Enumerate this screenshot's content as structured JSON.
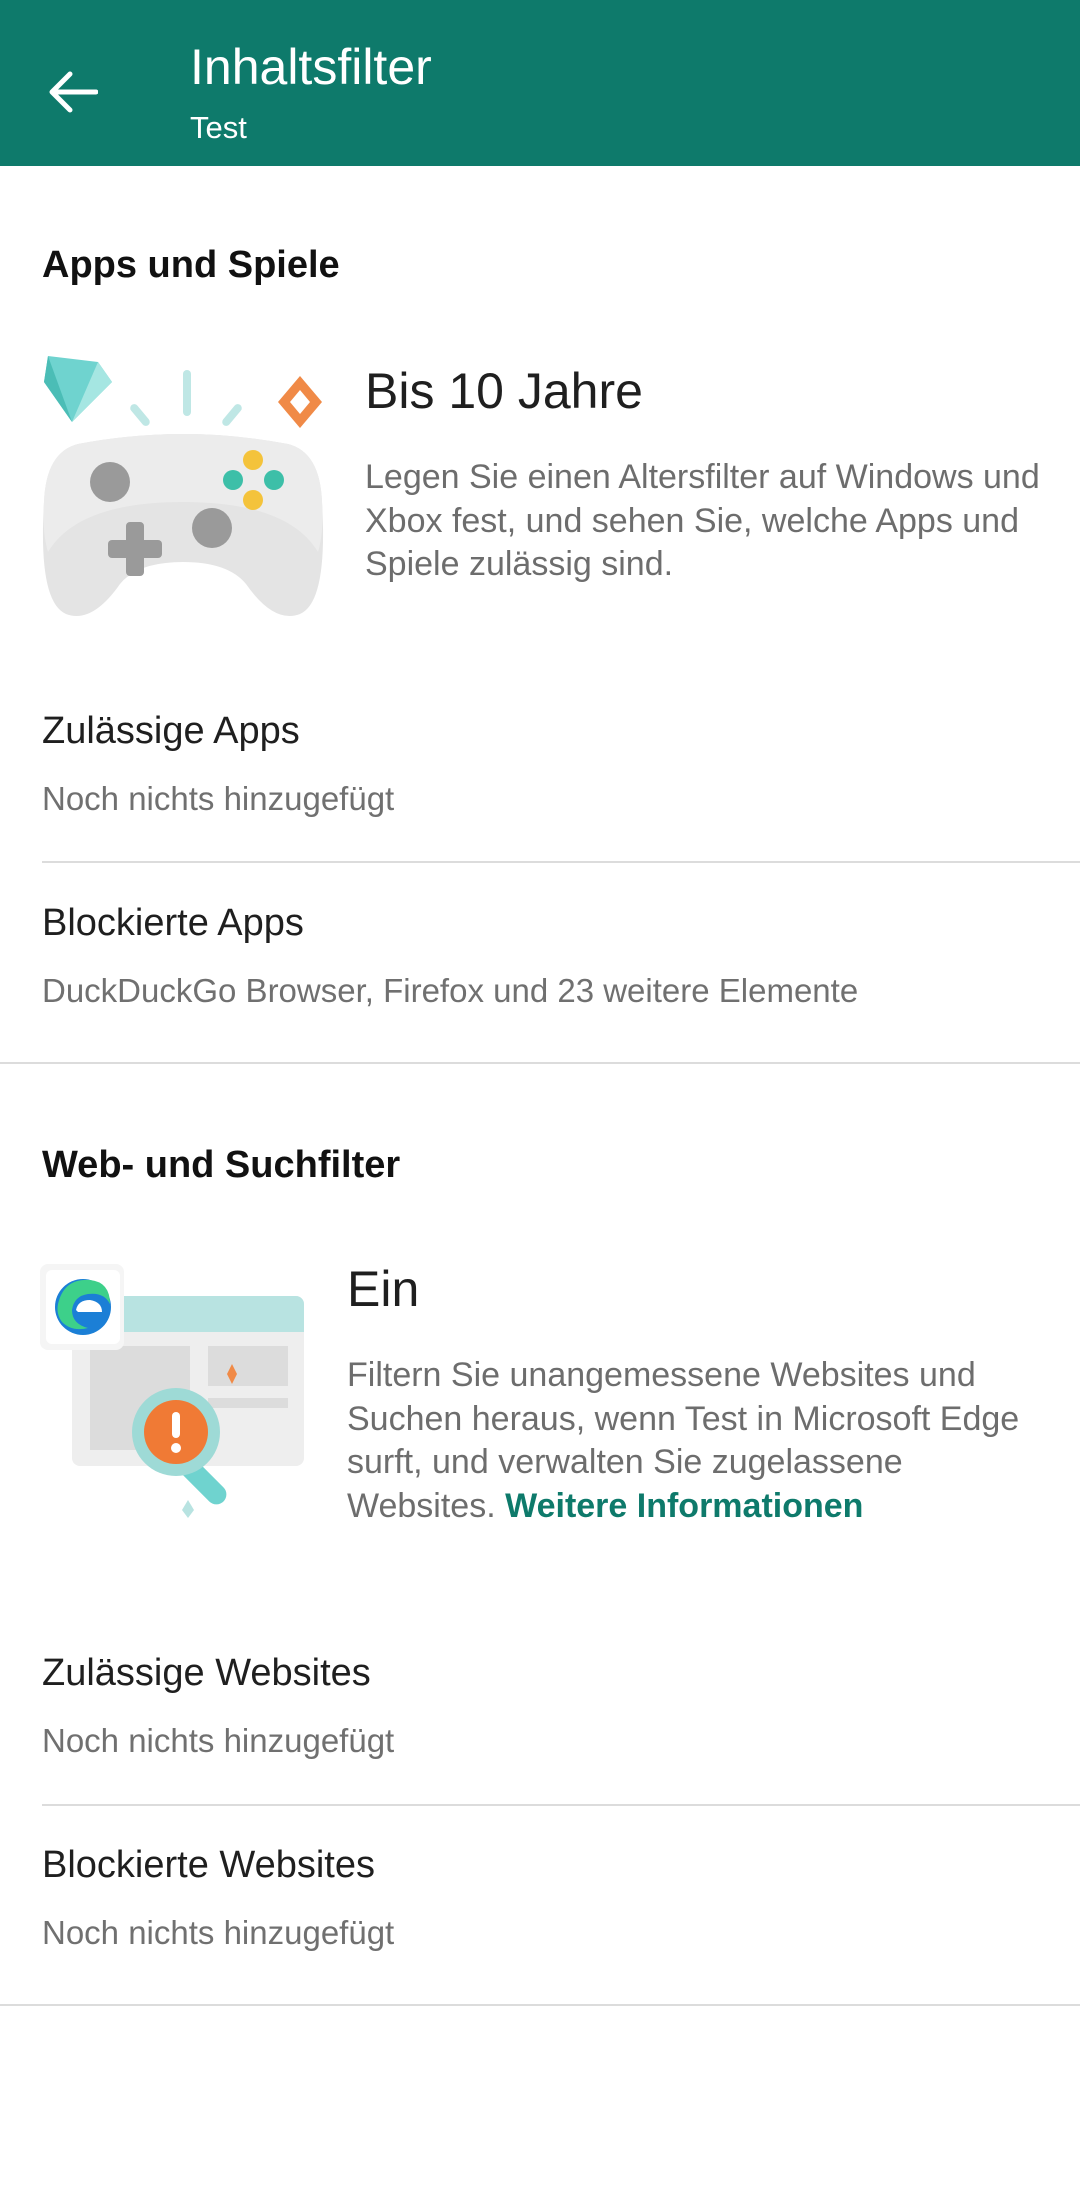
{
  "appbar": {
    "title": "Inhaltsfilter",
    "subtitle": "Test",
    "back_icon": "arrow-left-icon",
    "background": "#0e7a6b"
  },
  "apps_section": {
    "heading": "Apps und Spiele",
    "feature_title": "Bis 10 Jahre",
    "feature_description": "Legen Sie einen Altersfilter auf Windows und Xbox fest, und sehen Sie, welche Apps und Spiele zulässig sind.",
    "illustration_icon": "game-controller-icon",
    "items": [
      {
        "title": "Zulässige Apps",
        "subtitle": "Noch nichts hinzugefügt"
      },
      {
        "title": "Blockierte Apps",
        "subtitle": "DuckDuckGo Browser, Firefox und 23 weitere Elemente"
      }
    ]
  },
  "web_section": {
    "heading": "Web- und Suchfilter",
    "feature_title": "Ein",
    "feature_description": "Filtern Sie unangemessene Websites und Suchen heraus, wenn Test in Microsoft Edge surft, und verwalten Sie zugelassene Websites.",
    "link_text": "Weitere Informationen",
    "illustration_icon": "edge-browser-warning-icon",
    "items": [
      {
        "title": "Zulässige Websites",
        "subtitle": "Noch nichts hinzugefügt"
      },
      {
        "title": "Blockierte Websites",
        "subtitle": "Noch nichts hinzugefügt"
      }
    ]
  },
  "colors": {
    "accent": "#0e7a6b",
    "divider": "#dcdcdc"
  }
}
